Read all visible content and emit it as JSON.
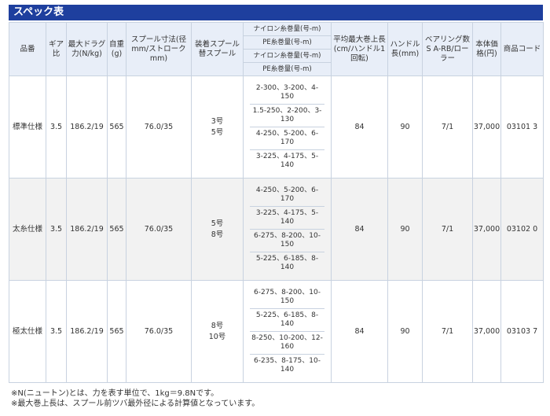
{
  "title": "スペック表",
  "headers": {
    "model": "品番",
    "gear": "ギア比",
    "drag": "最大ドラグ力(N/kg)",
    "weight": "自重(g)",
    "spool_dim": "スプール寸法(径mm/ストロークmm)",
    "spool": "装着スプール 替スプール",
    "capacity": [
      "ナイロン糸巻量(号-m)",
      "PE糸巻量(号-m)",
      "ナイロン糸巻量(号-m)",
      "PE糸巻量(号-m)"
    ],
    "retrieve": "平均最大巻上長(cm/ハンドル1回転)",
    "handle": "ハンドル長(mm)",
    "bearing": "ベアリング数S A-RB/ローラー",
    "price": "本体価格(円)",
    "code": "商品コード"
  },
  "rows": [
    {
      "model": "標準仕様",
      "gear": "3.5",
      "drag": "186.2/19",
      "weight": "565",
      "spool_dim": "76.0/35",
      "spool_main": "3号",
      "spool_spare": "5号",
      "capacity": [
        "2-300、3-200、4-150",
        "1.5-250、2-200、3-130",
        "4-250、5-200、6-170",
        "3-225、4-175、5-140"
      ],
      "retrieve": "84",
      "handle": "90",
      "bearing": "7/1",
      "price": "37,000",
      "code": "03101 3"
    },
    {
      "model": "太糸仕様",
      "gear": "3.5",
      "drag": "186.2/19",
      "weight": "565",
      "spool_dim": "76.0/35",
      "spool_main": "5号",
      "spool_spare": "8号",
      "capacity": [
        "4-250、5-200、6-170",
        "3-225、4-175、5-140",
        "6-275、8-200、10-150",
        "5-225、6-185、8-140"
      ],
      "retrieve": "84",
      "handle": "90",
      "bearing": "7/1",
      "price": "37,000",
      "code": "03102 0"
    },
    {
      "model": "極太仕様",
      "gear": "3.5",
      "drag": "186.2/19",
      "weight": "565",
      "spool_dim": "76.0/35",
      "spool_main": "8号",
      "spool_spare": "10号",
      "capacity": [
        "6-275、8-200、10-150",
        "5-225、6-185、8-140",
        "8-250、10-200、12-160",
        "6-235、8-175、10-140"
      ],
      "retrieve": "84",
      "handle": "90",
      "bearing": "7/1",
      "price": "37,000",
      "code": "03103 7"
    }
  ],
  "notes": [
    "※N(ニュートン)とは、力を表す単位で、1kg＝9.8Nです。",
    "※最大巻上長は、スプール前ツバ最外径による計算値となっています。"
  ]
}
